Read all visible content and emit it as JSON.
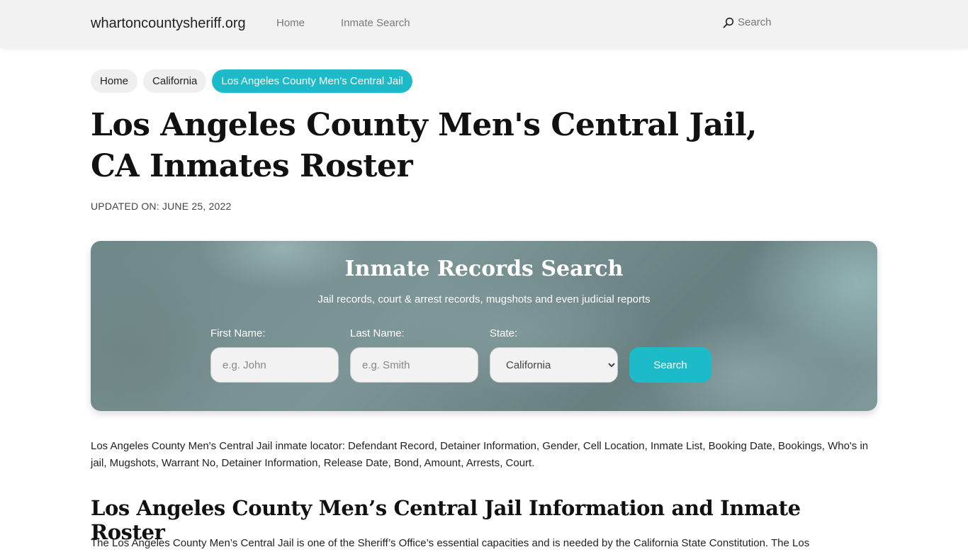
{
  "navbar": {
    "brand": "whartoncountysheriff.org",
    "links": [
      {
        "label": "Home"
      },
      {
        "label": "Inmate Search"
      }
    ],
    "search_label": "Search",
    "search_icon": "search-icon"
  },
  "breadcrumb": [
    {
      "label": "Home"
    },
    {
      "label": "California"
    },
    {
      "label": "Los Angeles County Men’s Central Jail",
      "active": true
    }
  ],
  "page": {
    "title": "Los Angeles County Men's Central Jail, CA Inmates Roster",
    "updated": "UPDATED ON: JUNE 25, 2022"
  },
  "search_panel": {
    "title": "Inmate Records Search",
    "subtitle": "Jail records, court & arrest records, mugshots and even judicial reports",
    "first_name": {
      "label": "First Name:",
      "placeholder": "e.g. John",
      "value": ""
    },
    "last_name": {
      "label": "Last Name:",
      "placeholder": "e.g. Smith",
      "value": ""
    },
    "state": {
      "label": "State:",
      "selected": "California"
    },
    "button_label": "Search",
    "colors": {
      "accent": "#1dbbc9"
    }
  },
  "content": {
    "intro": "Los Angeles County Men's Central Jail inmate locator: Defendant Record, Detainer Information, Gender, Cell Location, Inmate List, Booking Date, Bookings, Who's in jail, Mugshots, Warrant No, Detainer Information, Release Date, Bond, Amount, Arrests, Court.",
    "section_heading": "Los Angeles County Men’s Central Jail Information and Inmate Roster",
    "section_body": "The Los Angeles County Men’s Central Jail is one of the Sheriff’s Office’s essential capacities and is needed by the California State Constitution. The Los"
  }
}
